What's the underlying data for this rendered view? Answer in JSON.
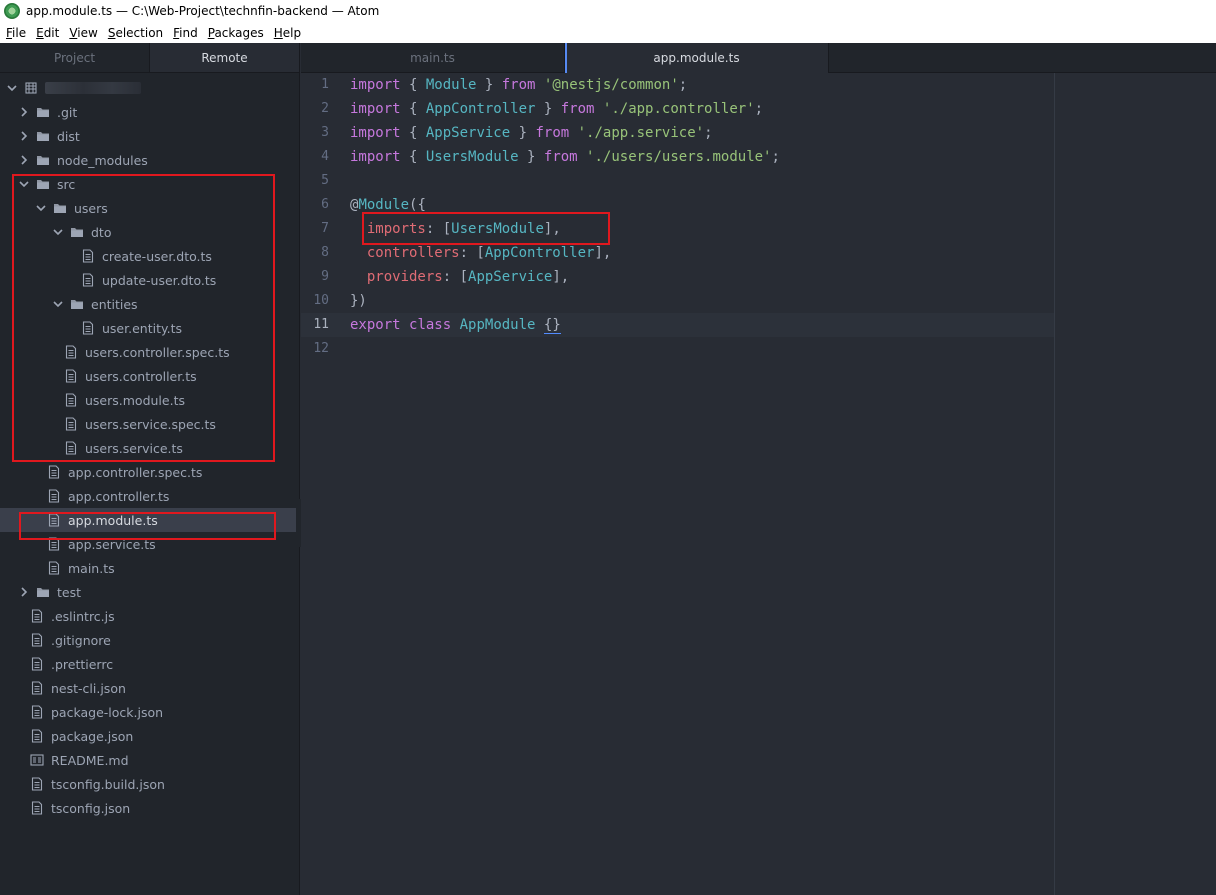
{
  "window": {
    "title": "app.module.ts — C:\\Web-Project\\technfin-backend — Atom"
  },
  "menu": [
    {
      "label": "File",
      "u": "F",
      "rest": "ile"
    },
    {
      "label": "Edit",
      "u": "E",
      "rest": "dit"
    },
    {
      "label": "View",
      "u": "V",
      "rest": "iew"
    },
    {
      "label": "Selection",
      "u": "S",
      "rest": "election"
    },
    {
      "label": "Find",
      "u": "F",
      "rest": "ind"
    },
    {
      "label": "Packages",
      "u": "P",
      "rest": "ackages"
    },
    {
      "label": "Help",
      "u": "H",
      "rest": "elp"
    }
  ],
  "sidebar": {
    "tabs": [
      {
        "label": "Project",
        "active": false
      },
      {
        "label": "Remote",
        "active": true
      }
    ],
    "tree": [
      {
        "name": "root",
        "label": "",
        "depth": 0,
        "type": "root",
        "expanded": true
      },
      {
        "name": "git",
        "label": ".git",
        "depth": 1,
        "type": "folder",
        "expanded": false
      },
      {
        "name": "dist",
        "label": "dist",
        "depth": 1,
        "type": "folder",
        "expanded": false
      },
      {
        "name": "node-modules",
        "label": "node_modules",
        "depth": 1,
        "type": "folder",
        "expanded": false
      },
      {
        "name": "src",
        "label": "src",
        "depth": 1,
        "type": "folder",
        "expanded": true
      },
      {
        "name": "users",
        "label": "users",
        "depth": 2,
        "type": "folder",
        "expanded": true
      },
      {
        "name": "dto",
        "label": "dto",
        "depth": 3,
        "type": "folder",
        "expanded": true
      },
      {
        "name": "create-user-dto",
        "label": "create-user.dto.ts",
        "depth": 4,
        "type": "file"
      },
      {
        "name": "update-user-dto",
        "label": "update-user.dto.ts",
        "depth": 4,
        "type": "file"
      },
      {
        "name": "entities",
        "label": "entities",
        "depth": 3,
        "type": "folder",
        "expanded": true
      },
      {
        "name": "user-entity",
        "label": "user.entity.ts",
        "depth": 4,
        "type": "file"
      },
      {
        "name": "users-controller-spec",
        "label": "users.controller.spec.ts",
        "depth": 3,
        "type": "file"
      },
      {
        "name": "users-controller",
        "label": "users.controller.ts",
        "depth": 3,
        "type": "file"
      },
      {
        "name": "users-module",
        "label": "users.module.ts",
        "depth": 3,
        "type": "file"
      },
      {
        "name": "users-service-spec",
        "label": "users.service.spec.ts",
        "depth": 3,
        "type": "file"
      },
      {
        "name": "users-service",
        "label": "users.service.ts",
        "depth": 3,
        "type": "file"
      },
      {
        "name": "app-controller-spec",
        "label": "app.controller.spec.ts",
        "depth": 2,
        "type": "file"
      },
      {
        "name": "app-controller",
        "label": "app.controller.ts",
        "depth": 2,
        "type": "file"
      },
      {
        "name": "app-module",
        "label": "app.module.ts",
        "depth": 2,
        "type": "file",
        "selected": true
      },
      {
        "name": "app-service",
        "label": "app.service.ts",
        "depth": 2,
        "type": "file"
      },
      {
        "name": "main",
        "label": "main.ts",
        "depth": 2,
        "type": "file"
      },
      {
        "name": "test",
        "label": "test",
        "depth": 1,
        "type": "folder",
        "expanded": false
      },
      {
        "name": "eslintrc",
        "label": ".eslintrc.js",
        "depth": 1,
        "type": "file"
      },
      {
        "name": "gitignore",
        "label": ".gitignore",
        "depth": 1,
        "type": "file"
      },
      {
        "name": "prettierrc",
        "label": ".prettierrc",
        "depth": 1,
        "type": "file"
      },
      {
        "name": "nest-cli",
        "label": "nest-cli.json",
        "depth": 1,
        "type": "file"
      },
      {
        "name": "package-lock",
        "label": "package-lock.json",
        "depth": 1,
        "type": "file"
      },
      {
        "name": "package",
        "label": "package.json",
        "depth": 1,
        "type": "file"
      },
      {
        "name": "readme",
        "label": "README.md",
        "depth": 1,
        "type": "markdown"
      },
      {
        "name": "tsconfig-build",
        "label": "tsconfig.build.json",
        "depth": 1,
        "type": "file"
      },
      {
        "name": "tsconfig",
        "label": "tsconfig.json",
        "depth": 1,
        "type": "file"
      }
    ]
  },
  "editor": {
    "tabs": [
      {
        "label": "main.ts",
        "active": false
      },
      {
        "label": "app.module.ts",
        "active": true
      }
    ],
    "current_line": 11,
    "lines": [
      [
        [
          "kw",
          "import"
        ],
        [
          "punc",
          " { "
        ],
        [
          "cls",
          "Module"
        ],
        [
          "punc",
          " } "
        ],
        [
          "kw",
          "from"
        ],
        [
          "punc",
          " "
        ],
        [
          "str",
          "'@nestjs/common'"
        ],
        [
          "punc",
          ";"
        ]
      ],
      [
        [
          "kw",
          "import"
        ],
        [
          "punc",
          " { "
        ],
        [
          "cls",
          "AppController"
        ],
        [
          "punc",
          " } "
        ],
        [
          "kw",
          "from"
        ],
        [
          "punc",
          " "
        ],
        [
          "str",
          "'./app.controller'"
        ],
        [
          "punc",
          ";"
        ]
      ],
      [
        [
          "kw",
          "import"
        ],
        [
          "punc",
          " { "
        ],
        [
          "cls",
          "AppService"
        ],
        [
          "punc",
          " } "
        ],
        [
          "kw",
          "from"
        ],
        [
          "punc",
          " "
        ],
        [
          "str",
          "'./app.service'"
        ],
        [
          "punc",
          ";"
        ]
      ],
      [
        [
          "kw",
          "import"
        ],
        [
          "punc",
          " { "
        ],
        [
          "cls",
          "UsersModule"
        ],
        [
          "punc",
          " } "
        ],
        [
          "kw",
          "from"
        ],
        [
          "punc",
          " "
        ],
        [
          "str",
          "'./users/users.module'"
        ],
        [
          "punc",
          ";"
        ]
      ],
      [],
      [
        [
          "punc",
          "@"
        ],
        [
          "cls",
          "Module"
        ],
        [
          "punc",
          "({"
        ]
      ],
      [
        [
          "punc",
          "  "
        ],
        [
          "prop",
          "imports"
        ],
        [
          "punc",
          ": ["
        ],
        [
          "cls",
          "UsersModule"
        ],
        [
          "punc",
          "],"
        ]
      ],
      [
        [
          "punc",
          "  "
        ],
        [
          "prop",
          "controllers"
        ],
        [
          "punc",
          ": ["
        ],
        [
          "cls",
          "AppController"
        ],
        [
          "punc",
          "],"
        ]
      ],
      [
        [
          "punc",
          "  "
        ],
        [
          "prop",
          "providers"
        ],
        [
          "punc",
          ": ["
        ],
        [
          "cls",
          "AppService"
        ],
        [
          "punc",
          "],"
        ]
      ],
      [
        [
          "punc",
          "})"
        ]
      ],
      [
        [
          "kw",
          "export"
        ],
        [
          "punc",
          " "
        ],
        [
          "kw",
          "class"
        ],
        [
          "punc",
          " "
        ],
        [
          "cls",
          "AppModule"
        ],
        [
          "punc",
          " "
        ],
        [
          "brace",
          "{}"
        ]
      ],
      []
    ]
  }
}
